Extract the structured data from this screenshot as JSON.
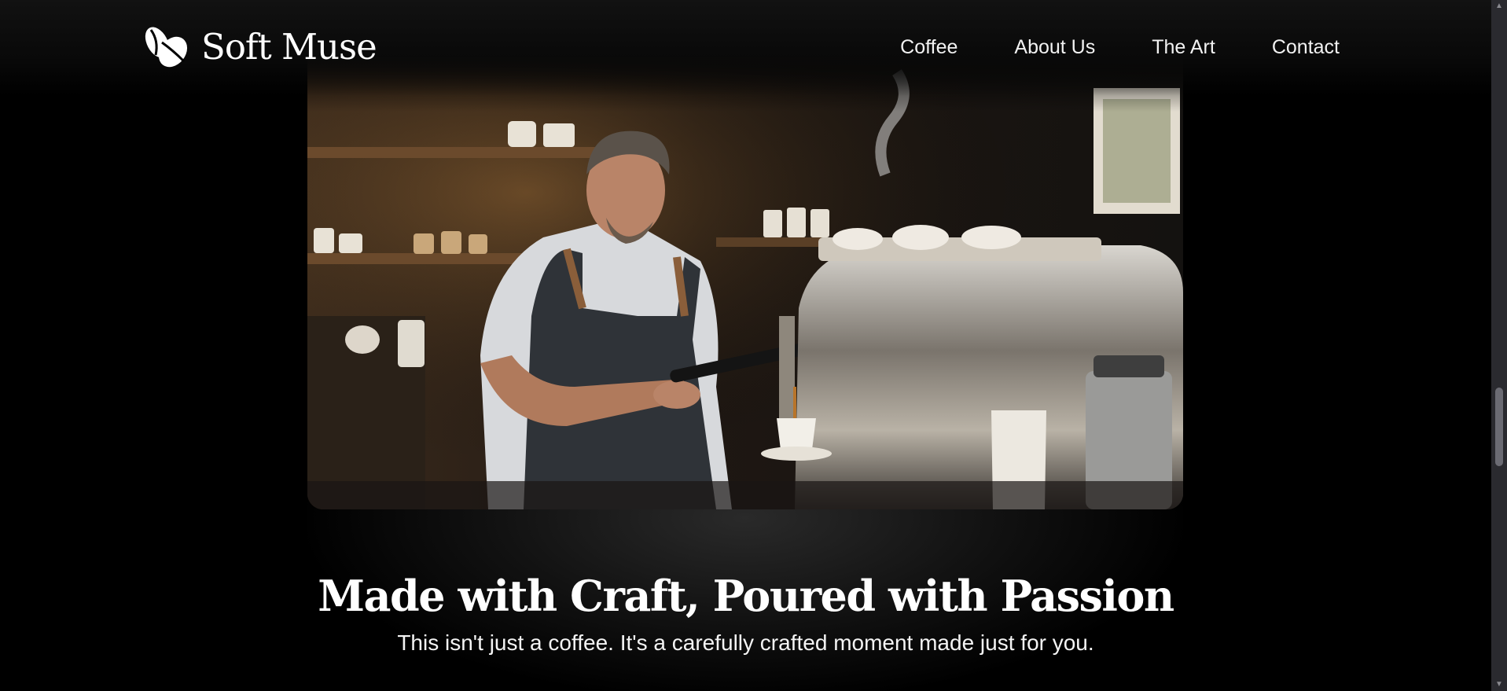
{
  "brand": {
    "name": "Soft Muse"
  },
  "nav": [
    {
      "label": "Coffee"
    },
    {
      "label": "About Us"
    },
    {
      "label": "The Art"
    },
    {
      "label": "Contact"
    }
  ],
  "hero": {
    "image": "barista-pouring-espresso-photo"
  },
  "section": {
    "heading": "Made with Craft, Poured with Passion",
    "subheading": "This isn't just a coffee. It's a carefully crafted moment made just for you."
  },
  "colors": {
    "background": "#000000",
    "text": "#ffffff",
    "scrollbar_track": "#2a2a2f",
    "scrollbar_thumb": "#6b6b73"
  }
}
